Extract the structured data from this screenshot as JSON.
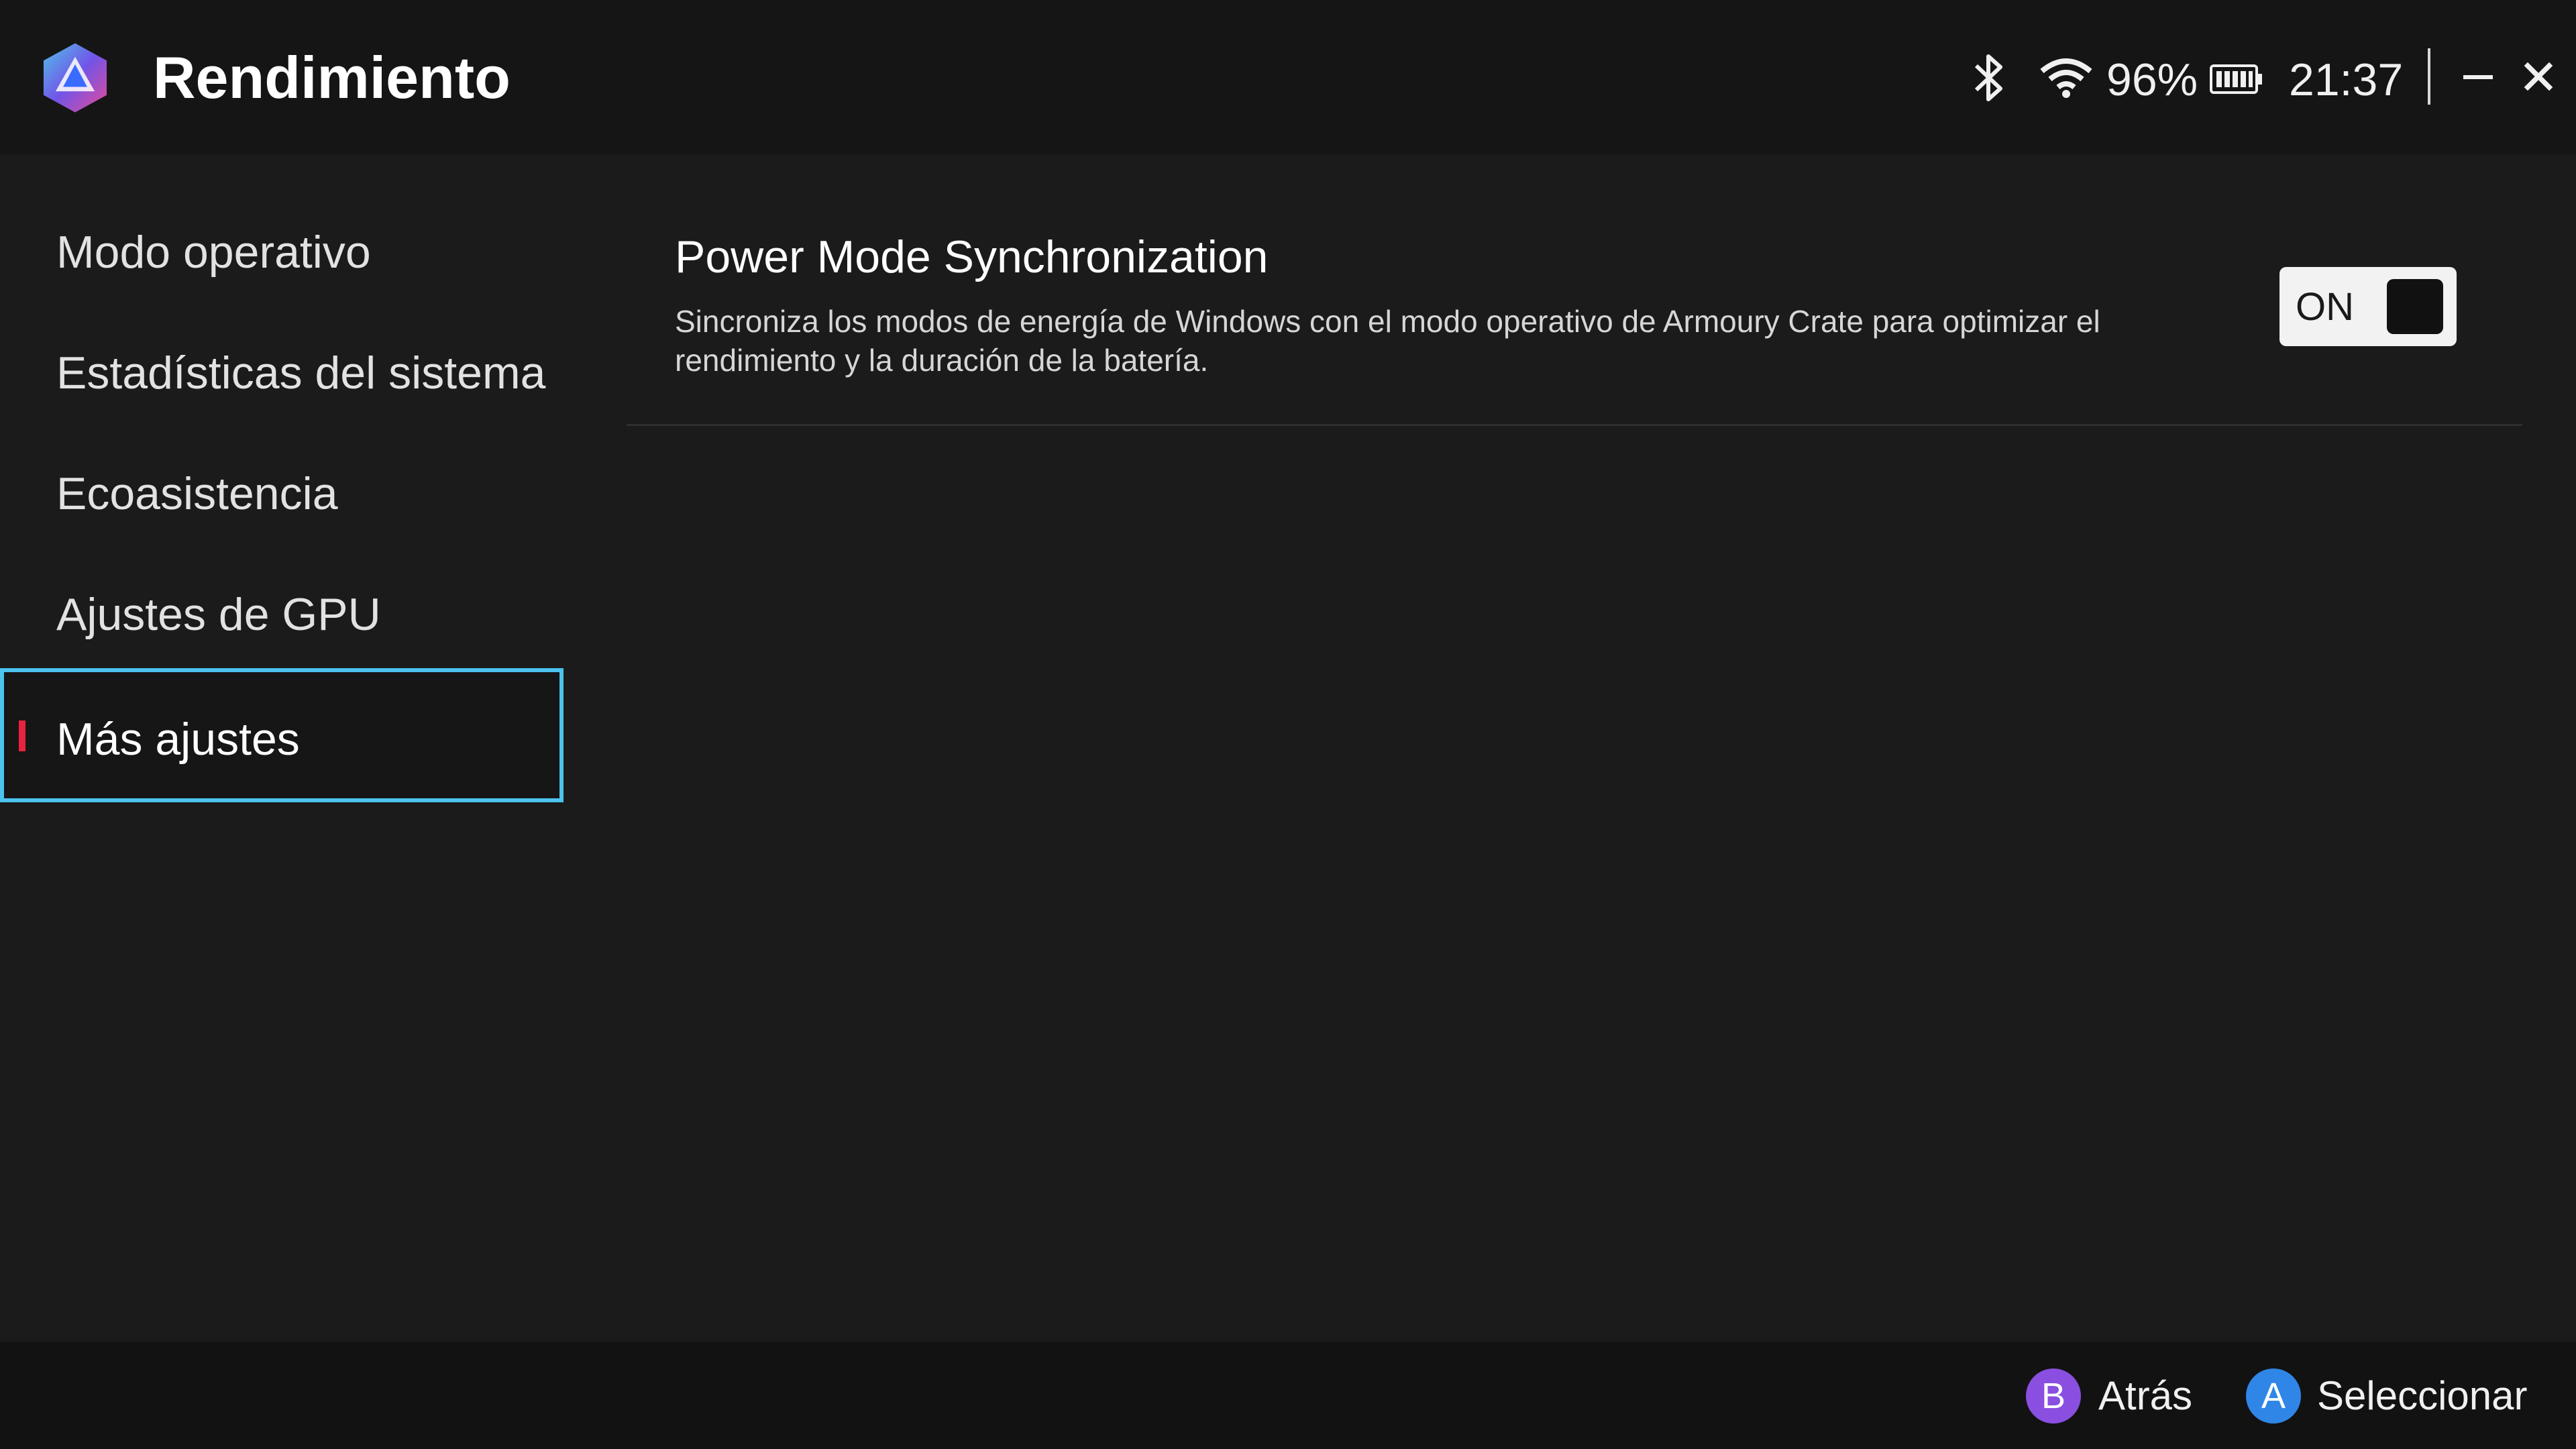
{
  "titlebar": {
    "title": "Rendimiento",
    "battery_percent": "96%",
    "time": "21:37",
    "icons": [
      "app-logo-icon",
      "bluetooth-icon",
      "wifi-icon",
      "battery-icon",
      "minimize-icon",
      "close-icon"
    ]
  },
  "sidebar": {
    "items": [
      {
        "label": "Modo operativo",
        "selected": false
      },
      {
        "label": "Estadísticas del sistema",
        "selected": false
      },
      {
        "label": "Ecoasistencia",
        "selected": false
      },
      {
        "label": "Ajustes de GPU",
        "selected": false
      },
      {
        "label": "Más ajustes",
        "selected": true
      }
    ]
  },
  "main": {
    "setting": {
      "title": "Power Mode Synchronization",
      "description": "Sincroniza los modos de energía de Windows con el modo operativo de Armoury Crate para optimizar el rendimiento y la duración de la batería.",
      "toggle_label": "ON",
      "toggle_state": true
    }
  },
  "footer": {
    "back": {
      "button": "B",
      "label": "Atrás"
    },
    "select": {
      "button": "A",
      "label": "Seleccionar"
    }
  },
  "colors": {
    "selection_border": "#4cc3ec",
    "accent_red": "#e8233f",
    "b_button": "#8a4fe0",
    "a_button": "#2f86e6"
  }
}
